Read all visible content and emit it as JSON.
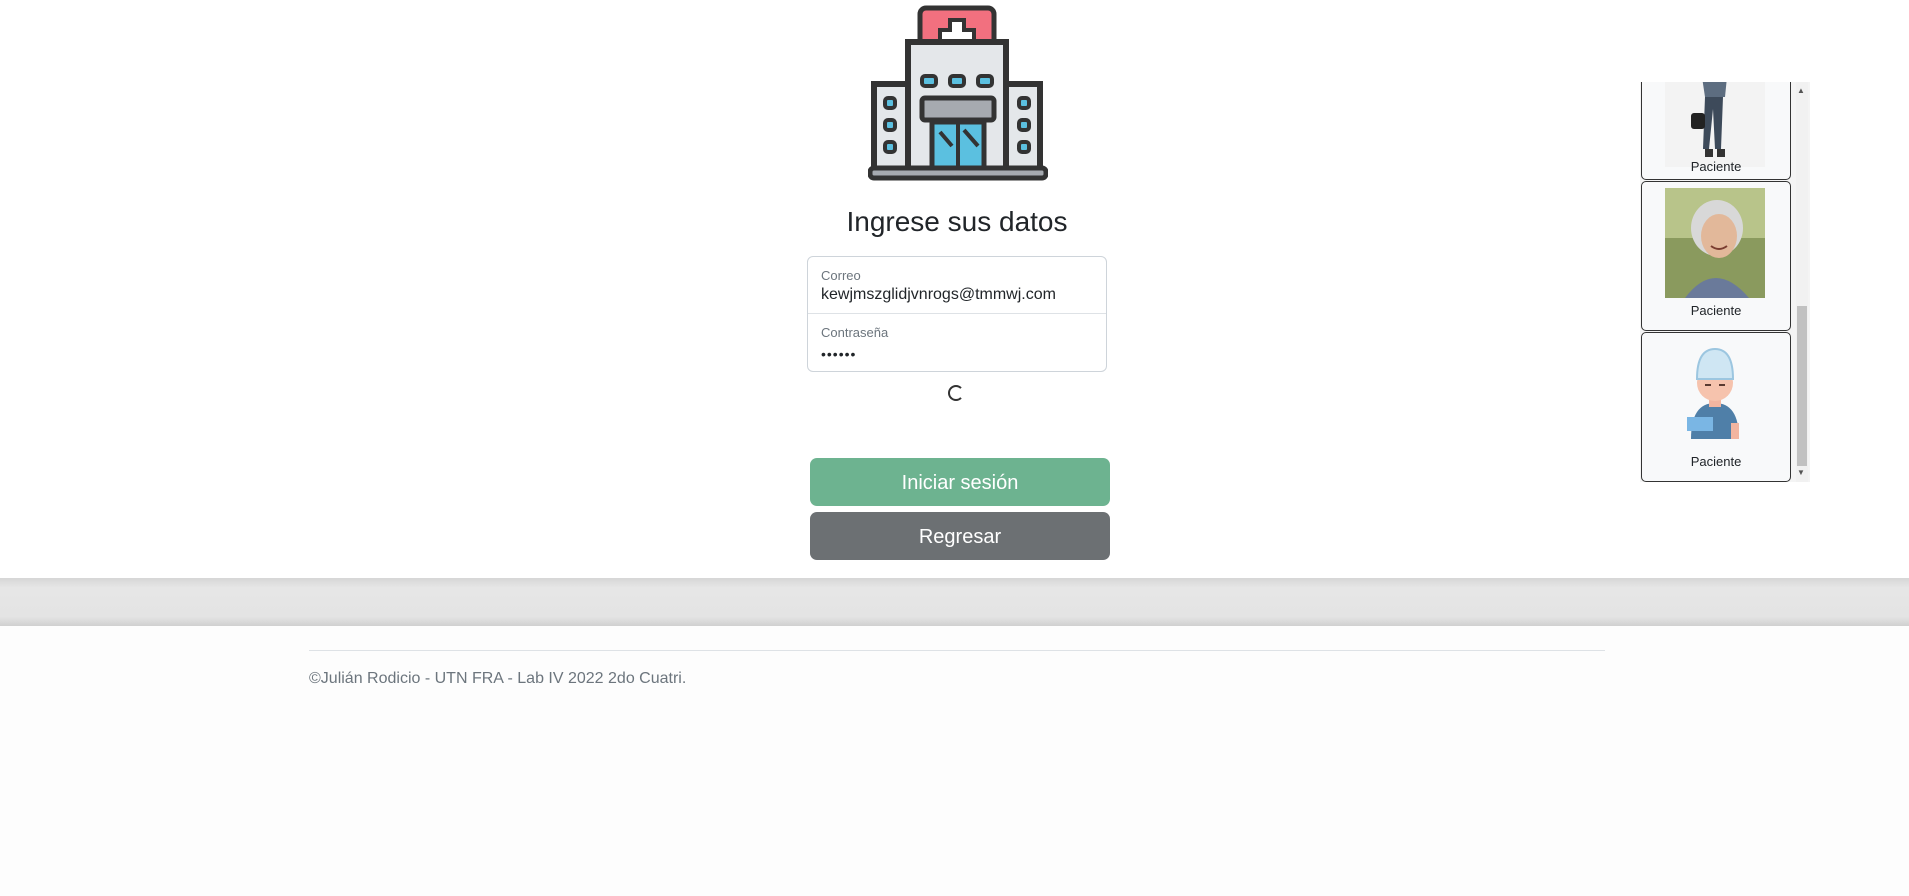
{
  "login": {
    "title": "Ingrese sus datos",
    "email_label": "Correo",
    "email_value": "kewjmszglidjvnrogs@tmmwj.com",
    "password_label": "Contraseña",
    "password_value": "••••••",
    "login_button": "Iniciar sesión",
    "back_button": "Regresar"
  },
  "users": [
    {
      "caption": "Paciente",
      "icon": "patient-walking-photo"
    },
    {
      "caption": "Paciente",
      "icon": "elderly-woman-photo"
    },
    {
      "caption": "Paciente",
      "icon": "injured-patient-avatar"
    }
  ],
  "footer": {
    "text": "©Julián Rodicio - UTN FRA - Lab IV 2022 2do Cuatri."
  },
  "colors": {
    "login": "#6db390",
    "back": "#6c7073",
    "hospital_red": "#f2707f",
    "window_blue": "#5bc0e0"
  }
}
